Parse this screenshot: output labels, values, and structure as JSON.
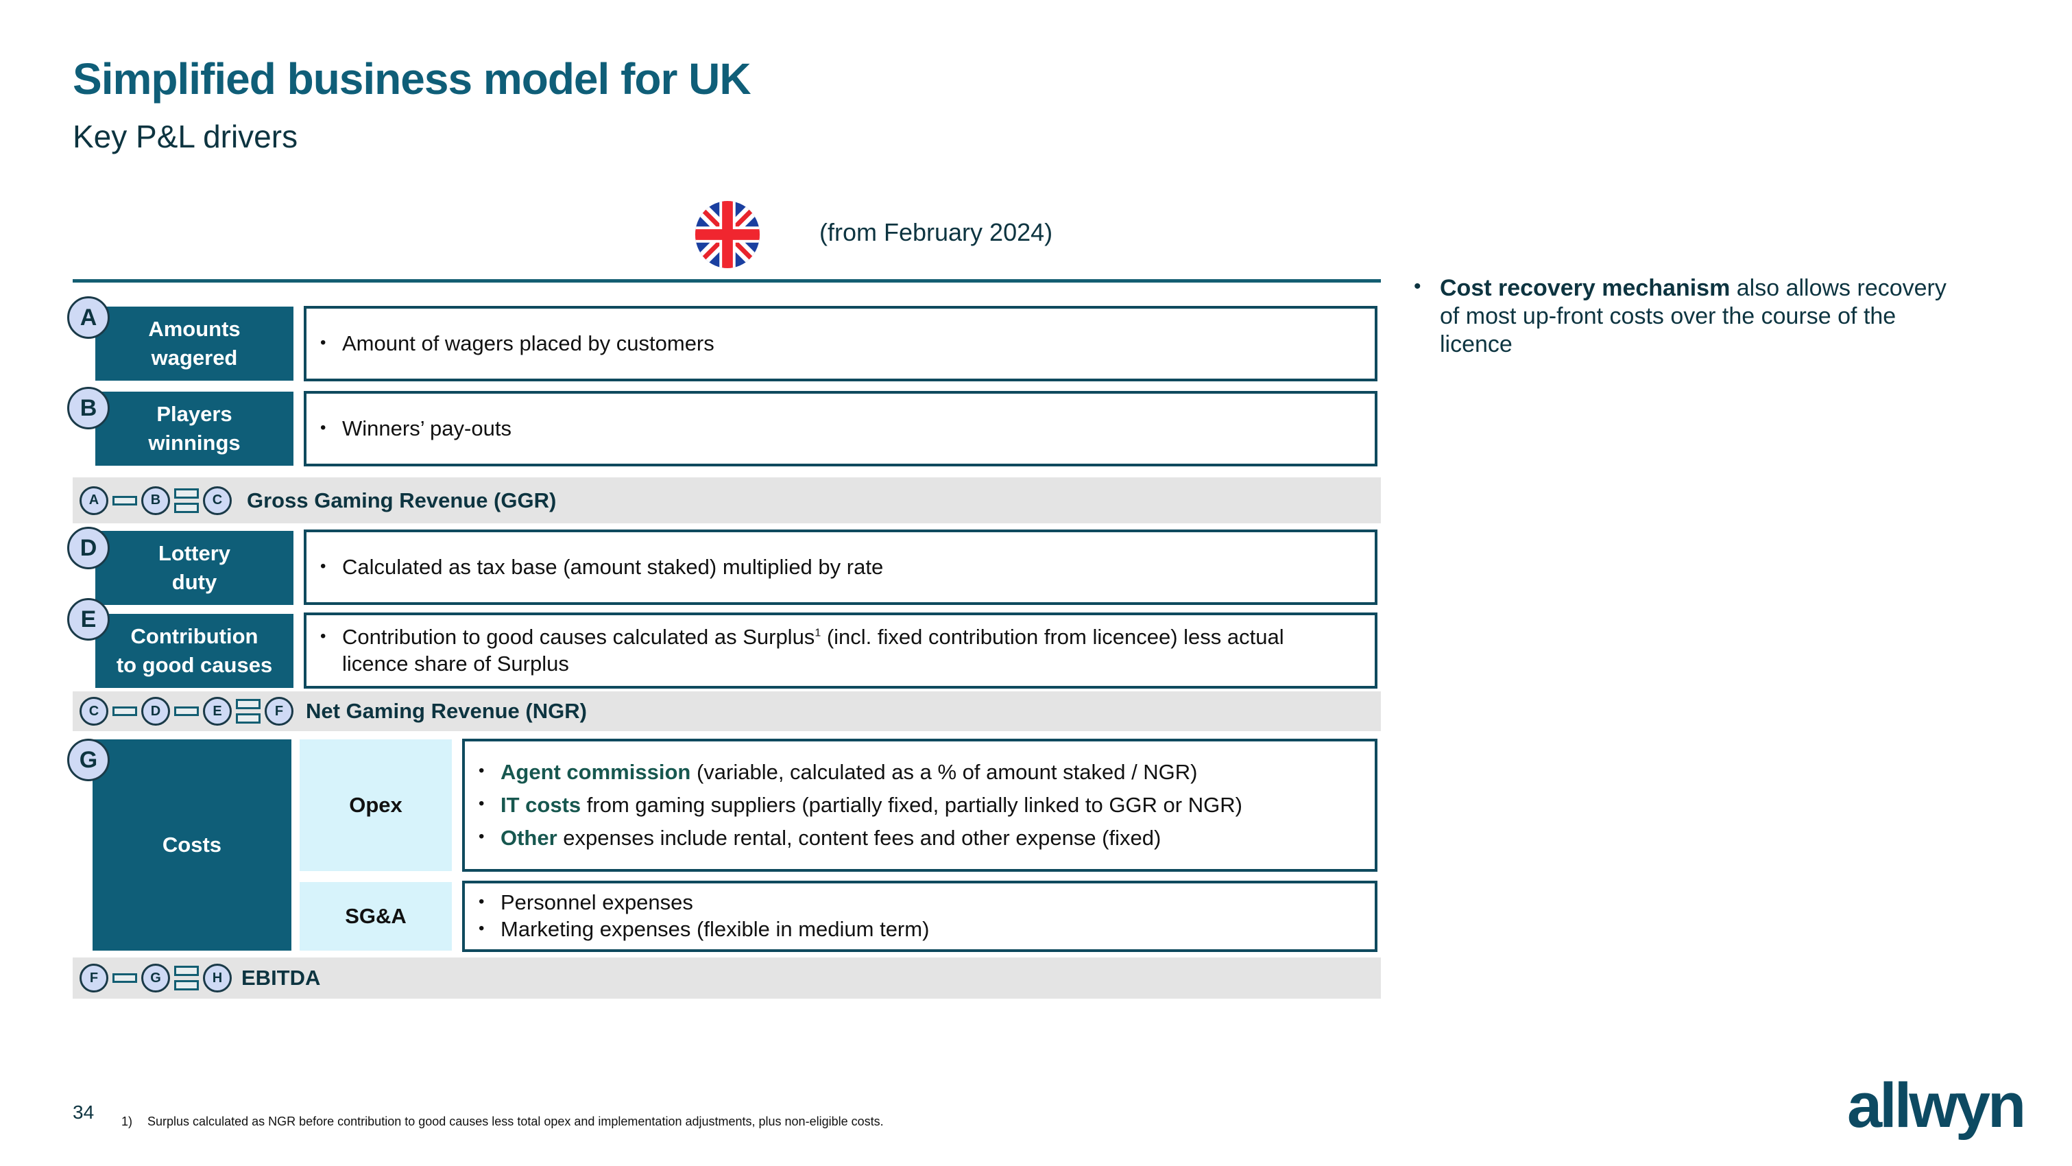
{
  "header": {
    "title": "Simplified business model for UK",
    "subtitle": "Key P&L drivers",
    "region_icon": "uk-flag-icon",
    "period": "(from February 2024)"
  },
  "rows": [
    {
      "letter": "A",
      "label_lines": [
        "Amounts",
        "wagered"
      ],
      "bullets": [
        "Amount of wagers placed by customers"
      ]
    },
    {
      "letter": "B",
      "label_lines": [
        "Players",
        "winnings"
      ],
      "bullets": [
        "Winners’ pay-outs"
      ]
    },
    {
      "letter": "D",
      "label_lines": [
        "Lottery",
        "duty"
      ],
      "bullets": [
        "Calculated as tax base (amount staked) multiplied by rate"
      ]
    },
    {
      "letter": "E",
      "label_lines": [
        "Contribution",
        "to good causes"
      ],
      "bullets": [
        {
          "before": "Contribution to good causes calculated as Surplus",
          "sup": "1",
          "after": " (incl. fixed contribution from licencee) less actual licence share of Surplus"
        }
      ]
    }
  ],
  "bands": [
    {
      "terms": [
        "A",
        "B"
      ],
      "result": "C",
      "label": "Gross Gaming Revenue (GGR)"
    },
    {
      "terms": [
        "C",
        "D",
        "E"
      ],
      "result": "F",
      "label": "Net Gaming Revenue (NGR)"
    },
    {
      "terms": [
        "F",
        "G"
      ],
      "result": "H",
      "label": "EBITDA"
    }
  ],
  "costs": {
    "letter": "G",
    "label": "Costs",
    "opex": {
      "label": "Opex",
      "bullets": [
        {
          "highlight": "Agent commission",
          "rest": " (variable, calculated as a % of amount staked / NGR)"
        },
        {
          "highlight": "IT costs",
          "rest": " from gaming suppliers (partially fixed, partially linked to GGR or NGR)"
        },
        {
          "highlight": "Other",
          "rest": " expenses include rental, content fees and other expense (fixed)"
        }
      ]
    },
    "sga": {
      "label": "SG&A",
      "bullets": [
        "Personnel expenses",
        "Marketing expenses (flexible in medium term)"
      ]
    }
  },
  "note": {
    "bold": "Cost recovery mechanism",
    "rest": " also allows recovery of most up-front costs over the course of the licence"
  },
  "footer": {
    "page_number": "34",
    "footnote_mark": "1)",
    "footnote": "Surplus calculated as NGR before contribution to good causes less total opex and implementation adjustments, plus non-eligible costs.",
    "logo": "allwyn"
  },
  "colors": {
    "brand_teal": "#0f5e78",
    "dark_text": "#0d3440",
    "highlight_green": "#17574f",
    "letter_circle": "#cfdaf5",
    "band_gray": "#e4e4e4",
    "light_cyan": "#d7f3fb"
  }
}
